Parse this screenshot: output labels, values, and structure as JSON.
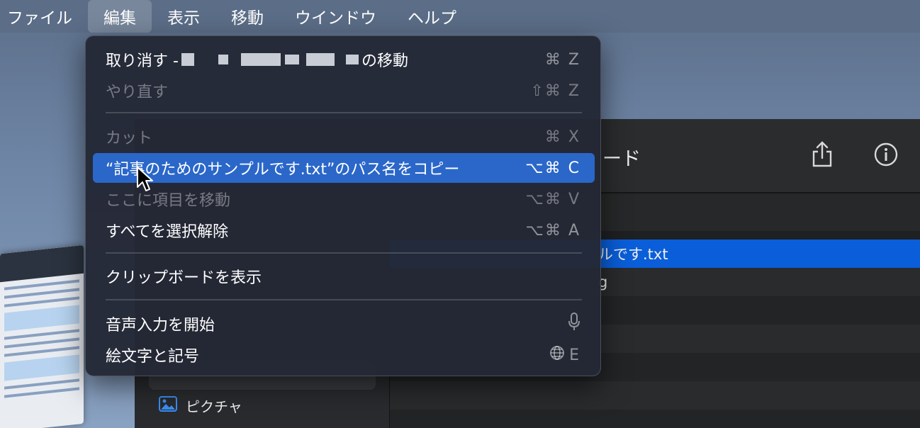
{
  "menubar": {
    "items": [
      "ファイル",
      "編集",
      "表示",
      "移動",
      "ウインドウ",
      "ヘルプ"
    ],
    "active_index": 1
  },
  "edit_menu": {
    "items": [
      {
        "label_prefix": "取り消す - ",
        "label_suffix": "の移動",
        "shortcut": "⌘ Z",
        "enabled": true
      },
      {
        "label": "やり直す",
        "shortcut": "⇧⌘ Z",
        "enabled": false
      },
      {
        "label": "カット",
        "shortcut": "⌘ X",
        "enabled": false
      },
      {
        "label": "“記事のためのサンプルです.txt”のパス名をコピー",
        "shortcut": "⌥⌘ C",
        "enabled": true,
        "highlighted": true
      },
      {
        "label": "ここに項目を移動",
        "shortcut": "⌥⌘ V",
        "enabled": false
      },
      {
        "label": "すべてを選択解除",
        "shortcut": "⌥⌘ A",
        "enabled": true
      },
      {
        "label": "クリップボードを表示",
        "shortcut": "",
        "enabled": true
      },
      {
        "label": "音声入力を開始",
        "shortcut_icon": "microphone-icon",
        "enabled": true
      },
      {
        "label": "絵文字と記号",
        "shortcut_icon": "globe-icon",
        "shortcut_suffix": "E",
        "enabled": true
      }
    ]
  },
  "finder": {
    "title_partial": "ード",
    "files": [
      "ルです.txt",
      "g"
    ],
    "sidebar_item": "ピクチャ"
  },
  "colors": {
    "highlight": "#2a67c9",
    "selection": "#0a5ed9",
    "menubar": "#5b6d87"
  }
}
